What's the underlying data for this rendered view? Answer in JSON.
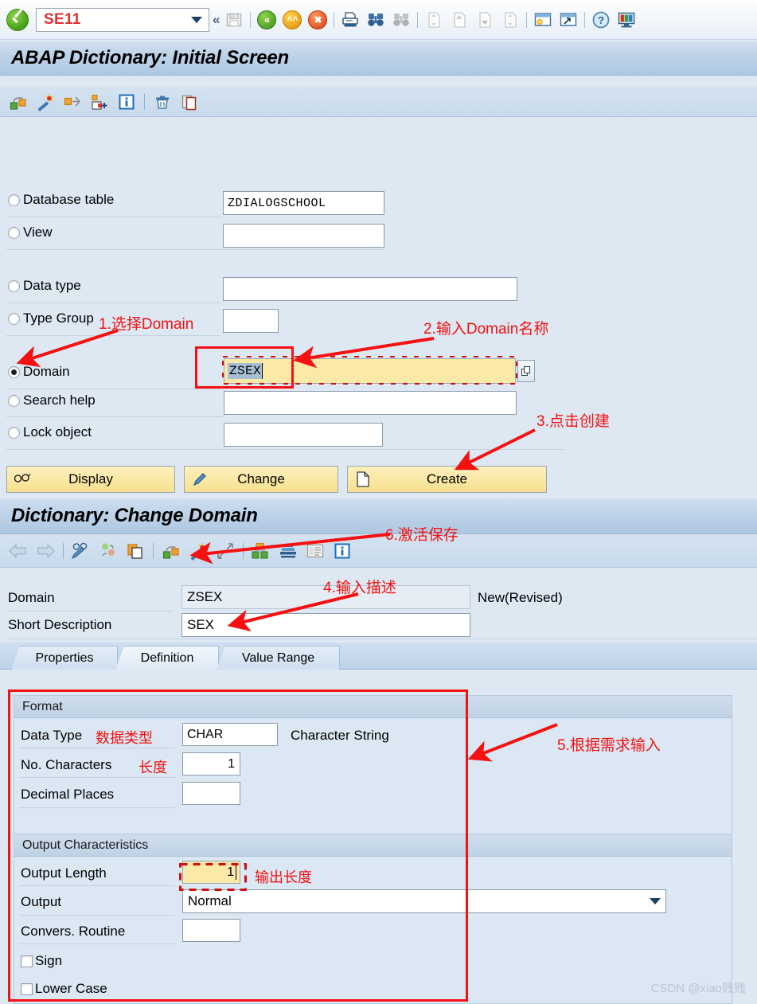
{
  "command_bar": {
    "ok_icon": "green-check-icon",
    "transaction_code": "SE11",
    "dropdown_icon": "chevron-down-icon",
    "collapse_icon": "double-chevron-left-icon",
    "buttons": [
      {
        "name": "save-button",
        "label": "Save",
        "icon": "floppy-disk-icon"
      },
      {
        "name": "back-button",
        "label": "Back",
        "icon": "green-back-icon"
      },
      {
        "name": "exit-button",
        "label": "Exit",
        "icon": "yellow-up-icon"
      },
      {
        "name": "cancel-button",
        "label": "Cancel",
        "icon": "red-cancel-icon"
      },
      {
        "name": "print-button",
        "label": "Print",
        "icon": "printer-icon"
      },
      {
        "name": "find-button",
        "label": "Find",
        "icon": "binoculars-icon"
      },
      {
        "name": "find-next-button",
        "label": "Find Next",
        "icon": "binoculars-plus-icon"
      },
      {
        "name": "first-page-button",
        "label": "First Page",
        "icon": "page-first-icon"
      },
      {
        "name": "previous-page-button",
        "label": "Previous Page",
        "icon": "page-up-icon"
      },
      {
        "name": "next-page-button",
        "label": "Next Page",
        "icon": "page-down-icon"
      },
      {
        "name": "last-page-button",
        "label": "Last Page",
        "icon": "page-last-icon"
      },
      {
        "name": "create-session-button",
        "label": "Create Session",
        "icon": "new-session-icon"
      },
      {
        "name": "create-shortcut-button",
        "label": "Create Shortcut",
        "icon": "shortcut-icon"
      },
      {
        "name": "help-button",
        "label": "Help",
        "icon": "question-help-icon"
      },
      {
        "name": "layout-menu-button",
        "label": "Customize Local Layout",
        "icon": "monitor-layout-icon"
      }
    ]
  },
  "screen1": {
    "title": "ABAP Dictionary: Initial Screen",
    "toolbar": [
      {
        "name": "display-object-button",
        "icon": "display-object-icon"
      },
      {
        "name": "other-object-button",
        "icon": "magic-wand-icon"
      },
      {
        "name": "where-used-list-button",
        "icon": "where-used-icon"
      },
      {
        "name": "activation-log-button",
        "icon": "activate-object-icon"
      },
      {
        "name": "info-button",
        "icon": "info-icon"
      },
      {
        "name": "delete-button",
        "icon": "trash-icon"
      },
      {
        "name": "copy-button",
        "icon": "copy-icon"
      }
    ],
    "options": [
      {
        "name": "database-table",
        "label": "Database table",
        "selected": false,
        "value": "ZDIALOGSCHOOL"
      },
      {
        "name": "view",
        "label": "View",
        "selected": false,
        "value": ""
      },
      {
        "name": "data-type",
        "label": "Data type",
        "selected": false,
        "value": ""
      },
      {
        "name": "type-group",
        "label": "Type Group",
        "selected": false,
        "value": ""
      },
      {
        "name": "domain",
        "label": "Domain",
        "selected": true,
        "value": "ZSEX"
      },
      {
        "name": "search-help",
        "label": "Search help",
        "selected": false,
        "value": ""
      },
      {
        "name": "lock-object",
        "label": "Lock object",
        "selected": false,
        "value": ""
      }
    ],
    "buttons": [
      {
        "name": "display-button",
        "label": "Display",
        "icon": "glasses-icon"
      },
      {
        "name": "change-button",
        "label": "Change",
        "icon": "pencil-icon"
      },
      {
        "name": "create-button",
        "label": "Create",
        "icon": "blank-page-icon"
      }
    ]
  },
  "screen2": {
    "title": "Dictionary: Change Domain",
    "toolbar": [
      {
        "name": "back-nav-button",
        "icon": "arrow-left-icon"
      },
      {
        "name": "forward-nav-button",
        "icon": "arrow-right-icon"
      },
      {
        "name": "display-change-button",
        "icon": "glasses-pencil-icon"
      },
      {
        "name": "where-used-list-button",
        "icon": "where-used-balls-icon"
      },
      {
        "name": "copy-object-button",
        "icon": "copy-object-icon"
      },
      {
        "name": "display-object-button",
        "icon": "display-object-icon"
      },
      {
        "name": "activate-button",
        "icon": "magic-wand-icon"
      },
      {
        "name": "expand-button",
        "icon": "expand-arrows-icon"
      },
      {
        "name": "check-button",
        "icon": "two-green-boxes-icon"
      },
      {
        "name": "print-preview-button",
        "icon": "stack-print-icon"
      },
      {
        "name": "documentation-button",
        "icon": "documentation-icon"
      },
      {
        "name": "info-button",
        "icon": "info-icon"
      }
    ],
    "fields": [
      {
        "name": "domain-name",
        "label": "Domain",
        "value": "ZSEX",
        "readonly": true
      },
      {
        "name": "short-description",
        "label": "Short Description",
        "value": "SEX",
        "readonly": false
      }
    ],
    "status": "New(Revised)",
    "tabs": [
      {
        "name": "tab-properties",
        "label": "Properties",
        "active": false
      },
      {
        "name": "tab-definition",
        "label": "Definition",
        "active": true
      },
      {
        "name": "tab-value-range",
        "label": "Value Range",
        "active": false
      }
    ],
    "format_group": {
      "title": "Format",
      "rows": [
        {
          "name": "data-type",
          "label": "Data Type",
          "value": "CHAR",
          "suffix": "Character String"
        },
        {
          "name": "no-characters",
          "label": "No. Characters",
          "value": "1",
          "suffix": ""
        },
        {
          "name": "decimal-places",
          "label": "Decimal Places",
          "value": "",
          "suffix": ""
        }
      ]
    },
    "output_group": {
      "title": "Output Characteristics",
      "rows": [
        {
          "name": "output-length",
          "label": "Output Length",
          "value": "1"
        },
        {
          "name": "output",
          "label": "Output",
          "value": "Normal"
        },
        {
          "name": "convers-routine",
          "label": "Convers. Routine",
          "value": ""
        }
      ],
      "checkboxes": [
        {
          "name": "sign-checkbox",
          "label": "Sign",
          "checked": false
        },
        {
          "name": "lower-case-checkbox",
          "label": "Lower Case",
          "checked": false
        }
      ]
    }
  },
  "annotations": [
    {
      "name": "annotation-step-1",
      "text": "1.选择Domain"
    },
    {
      "name": "annotation-step-2",
      "text": "2.输入Domain名称"
    },
    {
      "name": "annotation-step-3",
      "text": "3.点击创建"
    },
    {
      "name": "annotation-step-4",
      "text": "4.输入描述"
    },
    {
      "name": "annotation-step-5",
      "text": "5.根据需求输入"
    },
    {
      "name": "annotation-step-6",
      "text": "6.激活保存"
    },
    {
      "name": "annotation-data-type",
      "text": "数据类型"
    },
    {
      "name": "annotation-length",
      "text": "长度"
    },
    {
      "name": "annotation-output-length",
      "text": "输出长度"
    }
  ],
  "watermark": "CSDN @xiao贱贱",
  "colors": {
    "annotation_red": "#f51111",
    "background": "#dde8f3",
    "field_highlight": "#fbe9a8",
    "button_yellow": "#f7e08e",
    "title_band": "#bdd2e8",
    "command_text": "#e03030"
  }
}
